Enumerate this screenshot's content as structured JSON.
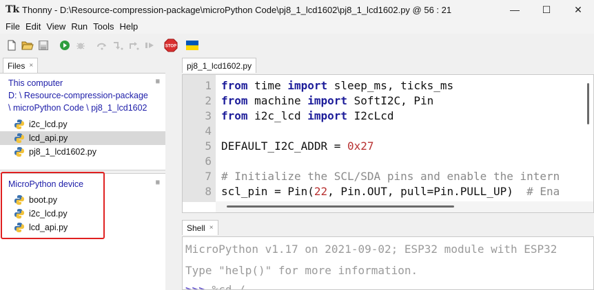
{
  "window": {
    "title": "Thonny  -  D:\\Resource-compression-package\\microPython Code\\pj8_1_lcd1602\\pj8_1_lcd1602.py  @  56 : 21",
    "logo": "Tk",
    "minimize": "—",
    "maximize": "☐",
    "close": "✕"
  },
  "menu": [
    "File",
    "Edit",
    "View",
    "Run",
    "Tools",
    "Help"
  ],
  "toolbar": {
    "icons": [
      "new-file-icon",
      "open-file-icon",
      "save-icon",
      "run-icon",
      "debug-icon",
      "step-over-icon",
      "step-into-icon",
      "step-out-icon",
      "resume-icon",
      "stop-icon",
      "ukraine-flag-icon"
    ],
    "stop_label": "STOP",
    "colors": {
      "run": "#2e9e3e",
      "stop": "#d93030",
      "flag_top": "#0057b7",
      "flag_bottom": "#ffd700"
    }
  },
  "files_tab": {
    "label": "Files",
    "close": "×"
  },
  "this_computer": {
    "title": "This computer",
    "path_line1": "D: \\ Resource-compression-package",
    "path_line2": "\\ microPython Code \\ pj8_1_lcd1602",
    "menu": "≡",
    "files": [
      "i2c_lcd.py",
      "lcd_api.py",
      "pj8_1_lcd1602.py"
    ],
    "selected_index": 1
  },
  "device": {
    "title": "MicroPython device",
    "menu": "≡",
    "files": [
      "boot.py",
      "i2c_lcd.py",
      "lcd_api.py"
    ]
  },
  "editor": {
    "tab_label": "pj8_1_lcd1602.py",
    "tab_close": "×",
    "line_numbers": [
      "1",
      "2",
      "3",
      "4",
      "5",
      "6",
      "7",
      "8"
    ],
    "lines": [
      [
        {
          "t": "from",
          "c": "kw"
        },
        {
          "t": " time ",
          "c": ""
        },
        {
          "t": "import",
          "c": "kw"
        },
        {
          "t": " sleep_ms, ticks_ms",
          "c": ""
        }
      ],
      [
        {
          "t": "from",
          "c": "kw"
        },
        {
          "t": " machine ",
          "c": ""
        },
        {
          "t": "import",
          "c": "kw"
        },
        {
          "t": " SoftI2C, Pin",
          "c": ""
        }
      ],
      [
        {
          "t": "from",
          "c": "kw"
        },
        {
          "t": " i2c_lcd ",
          "c": ""
        },
        {
          "t": "import",
          "c": "kw"
        },
        {
          "t": " I2cLcd",
          "c": ""
        }
      ],
      [],
      [
        {
          "t": "DEFAULT_I2C_ADDR = ",
          "c": ""
        },
        {
          "t": "0x27",
          "c": "num"
        }
      ],
      [],
      [
        {
          "t": "# Initialize the SCL/SDA pins and enable the intern",
          "c": "cmt"
        }
      ],
      [
        {
          "t": "scl_pin = Pin(",
          "c": ""
        },
        {
          "t": "22",
          "c": "num"
        },
        {
          "t": ", Pin.OUT, pull=Pin.PULL_UP)  ",
          "c": ""
        },
        {
          "t": "# Ena",
          "c": "cmt"
        }
      ]
    ]
  },
  "shell": {
    "tab_label": "Shell",
    "tab_close": "×",
    "line1": "MicroPython v1.17 on 2021-09-02; ESP32 module with ESP32",
    "line2": "Type \"help()\" for more information.",
    "prompt": ">>>",
    "command": " %cd /"
  }
}
